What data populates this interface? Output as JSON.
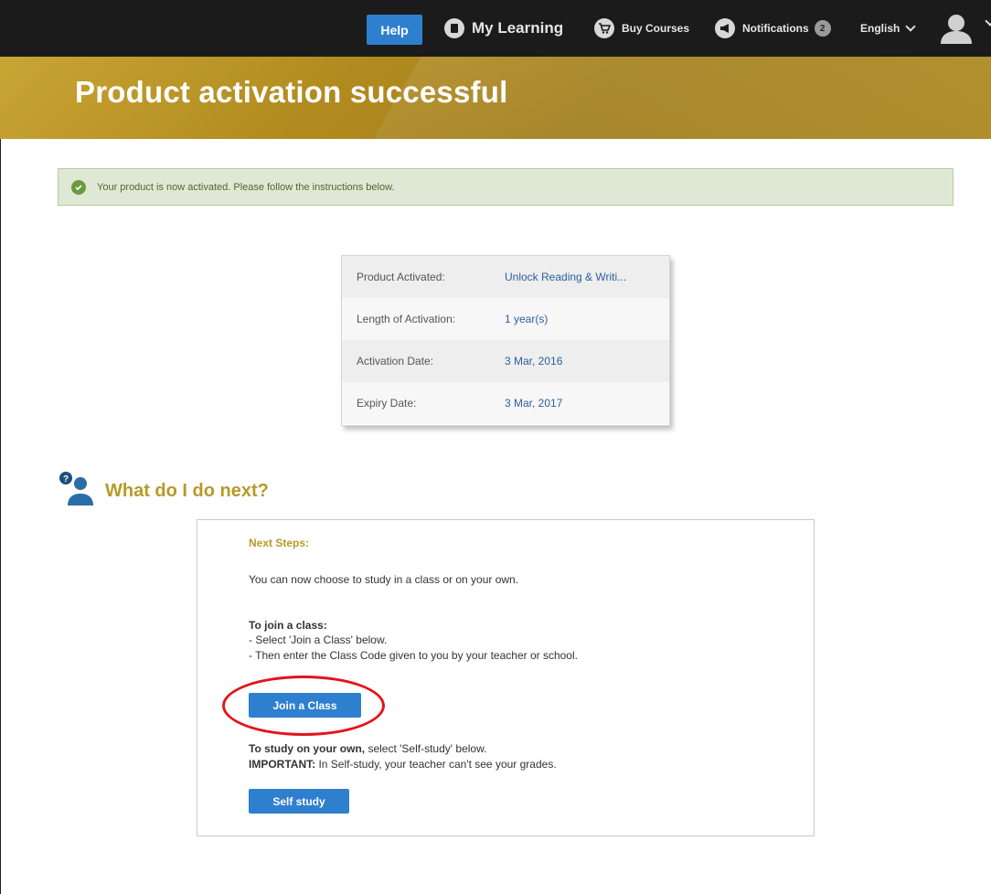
{
  "topbar": {
    "help_label": "Help",
    "my_learning_label": "My Learning",
    "buy_courses_label": "Buy Courses",
    "notifications_label": "Notifications",
    "notifications_count": "2",
    "language_label": "English"
  },
  "banner": {
    "title": "Product activation successful"
  },
  "alert": {
    "text": "Your product is now activated. Please follow the instructions below."
  },
  "product_info": {
    "rows": [
      {
        "label": "Product Activated:",
        "value": "Unlock Reading & Writi..."
      },
      {
        "label": "Length of Activation:",
        "value": "1 year(s)"
      },
      {
        "label": "Activation Date:",
        "value": "3 Mar, 2016"
      },
      {
        "label": "Expiry Date:",
        "value": "3 Mar, 2017"
      }
    ]
  },
  "next": {
    "heading": "What do I do next?"
  },
  "steps": {
    "title": "Next Steps:",
    "intro": "You can now choose to study in a class or on your own.",
    "join_heading": "To join a class:",
    "join_step1": "- Select 'Join a Class' below.",
    "join_step2": "- Then enter the Class Code given to you by your teacher or school.",
    "join_button": "Join a Class",
    "self_bold": "To study on your own,",
    "self_rest": " select 'Self-study' below.",
    "important_bold": "IMPORTANT:",
    "important_rest": " In Self-study, your teacher can't see your grades.",
    "self_button": "Self study"
  },
  "colors": {
    "accent_blue": "#2f7fcf",
    "banner_gold": "#b08a1e",
    "heading_gold": "#b79a28",
    "success_green": "#6a9a3c",
    "annotation_red": "#e3141b"
  }
}
